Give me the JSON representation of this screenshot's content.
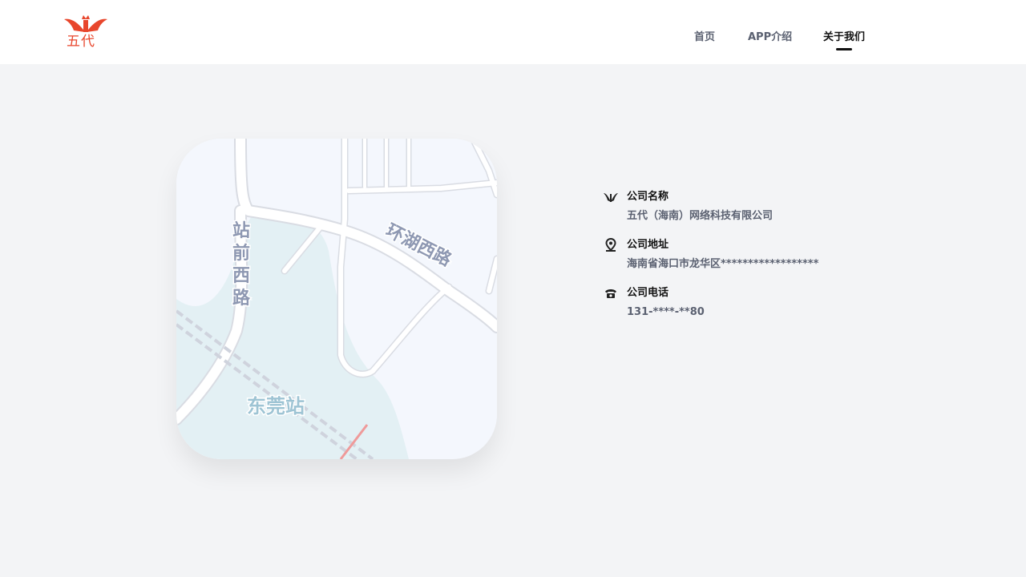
{
  "brand": {
    "logo_text": "五代",
    "logo_icon": "wings-crown-logo",
    "brand_color": "#e8462c"
  },
  "nav": {
    "items": [
      {
        "label": "首页"
      },
      {
        "label": "APP介绍"
      },
      {
        "label": "关于我们"
      }
    ],
    "active_index": 2
  },
  "map": {
    "labels": {
      "road_1": "环湖西路",
      "road_2_chars": [
        "站",
        "前",
        "西",
        "路"
      ],
      "station": "东莞站"
    },
    "colors": {
      "land": "#f4f7fd",
      "water": "#e3f0f4",
      "road": "#ffffff",
      "road_edge": "#d9dce3",
      "label": "#8e98b2",
      "station_label": "#9ec4d4",
      "rail": "#cfd3dd",
      "rail_red": "#ef9a9a"
    }
  },
  "company": {
    "name": {
      "icon": "wings-icon",
      "label": "公司名称",
      "value": "五代（海南）网络科技有限公司"
    },
    "address": {
      "icon": "location-pin-icon",
      "label": "公司地址",
      "value": "海南省海口市龙华区******************"
    },
    "phone": {
      "icon": "telephone-icon",
      "label": "公司电话",
      "value": "131-****-**80"
    }
  }
}
